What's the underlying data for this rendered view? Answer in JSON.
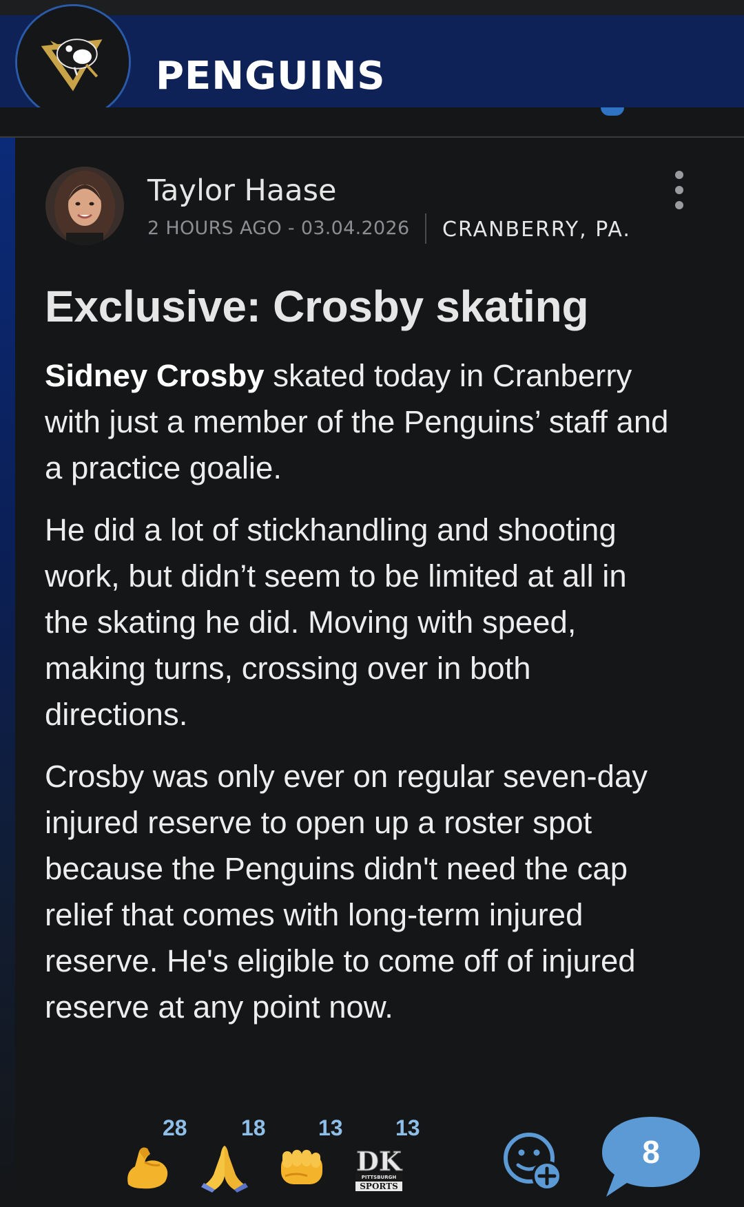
{
  "header": {
    "team_name": "PENGUINS",
    "logo_icon": "penguins-logo-icon",
    "banner_color": "#0f2257"
  },
  "post": {
    "author": "Taylor Haase",
    "timestamp": "2 HOURS AGO - 03.04.2026",
    "location": "CRANBERRY, PA.",
    "headline": "Exclusive: Crosby skating",
    "paragraphs": [
      {
        "bold": "Sidney Crosby",
        "text": " skated today in Cranberry with just a member of the Penguins’ staff and a practice goalie."
      },
      {
        "bold": "",
        "text": "He did a lot of stickhandling and shooting work, but didn’t seem to be limited at all in the skating he did. Moving with speed, making turns, crossing over in both directions."
      },
      {
        "bold": "",
        "text": "Crosby was only ever on regular seven-day injured reserve to open up a roster spot because the Penguins didn't need the cap relief that comes with long-term injured reserve. He's eligible to come off of injured reserve at any point now."
      }
    ]
  },
  "reactions": [
    {
      "icon": "flexed-biceps-icon",
      "count": "28"
    },
    {
      "icon": "folded-hands-icon",
      "count": "18"
    },
    {
      "icon": "oncoming-fist-icon",
      "count": "13"
    },
    {
      "icon": "dk-pittsburgh-sports-icon",
      "count": "13",
      "logo_text": [
        "DK",
        "PITTSBURGH",
        "SPORTS"
      ]
    }
  ],
  "actions": {
    "add_reaction_icon": "add-reaction-icon",
    "comment_count": "8",
    "comment_color": "#5c9ad6"
  }
}
